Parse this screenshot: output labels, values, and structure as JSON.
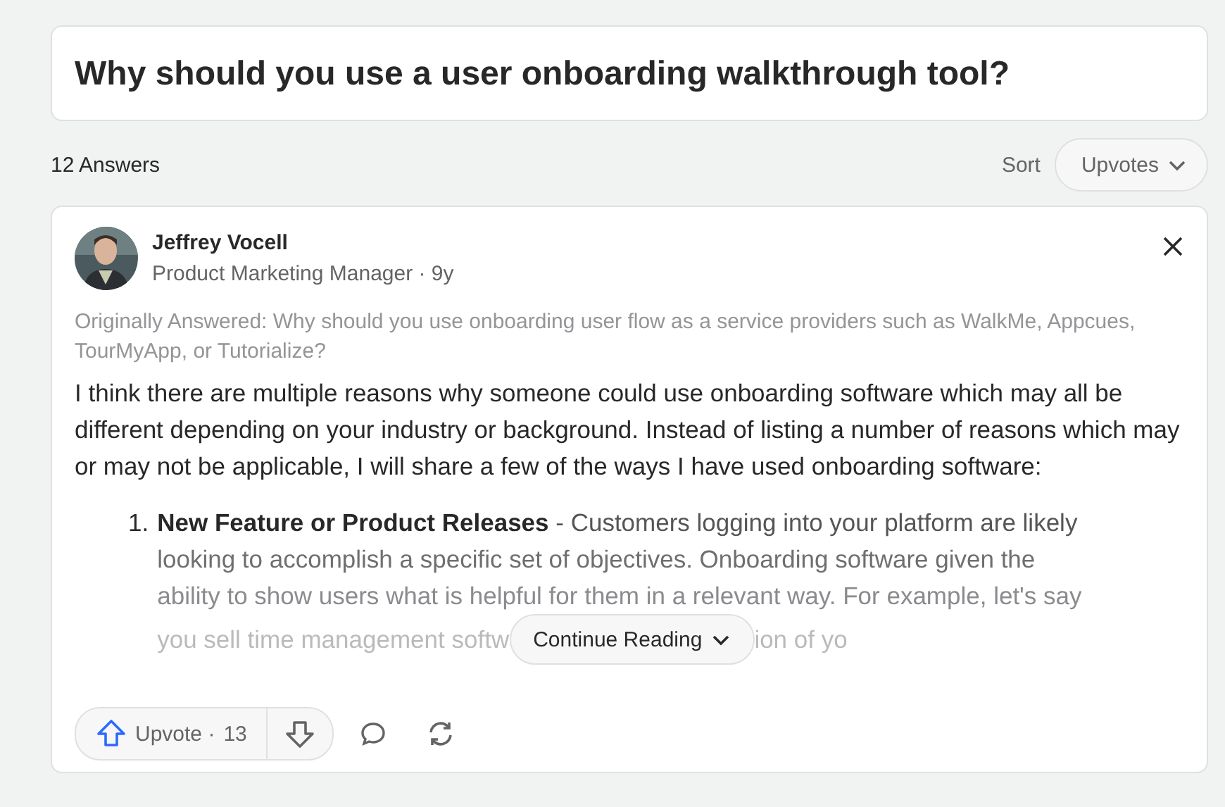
{
  "question": {
    "title": "Why should you use a user onboarding walkthrough tool?"
  },
  "answers_header": {
    "count": "12 Answers",
    "sort_label": "Sort",
    "sort_value": "Upvotes"
  },
  "answer": {
    "author": "Jeffrey Vocell",
    "credential": "Product Marketing Manager · 9y",
    "originally_answered": "Originally Answered: Why should you use onboarding user flow as a service providers such as WalkMe, Appcues, TourMyApp, or Tutorialize?",
    "paragraph": "I think there are multiple reasons why someone could use onboarding software which may all be different depending on your industry or background. Instead of listing a number of reasons which may or may not be applicable, I will share a few of the ways I have used onboarding software:",
    "list_marker": "1.",
    "list_lines": [
      "**New Feature or Product Releases** - Customers logging into your platform are likely",
      "looking to accomplish a specific set of objectives. Onboarding software given the",
      "ability to show users what is helpful for them in a relevant way. For example, let's say"
    ],
    "faded_fragments": [
      "you sell time management softw",
      "ion of yo"
    ],
    "continue_reading": "Continue Reading",
    "upvote_label": "Upvote ·",
    "upvote_count": "13"
  }
}
